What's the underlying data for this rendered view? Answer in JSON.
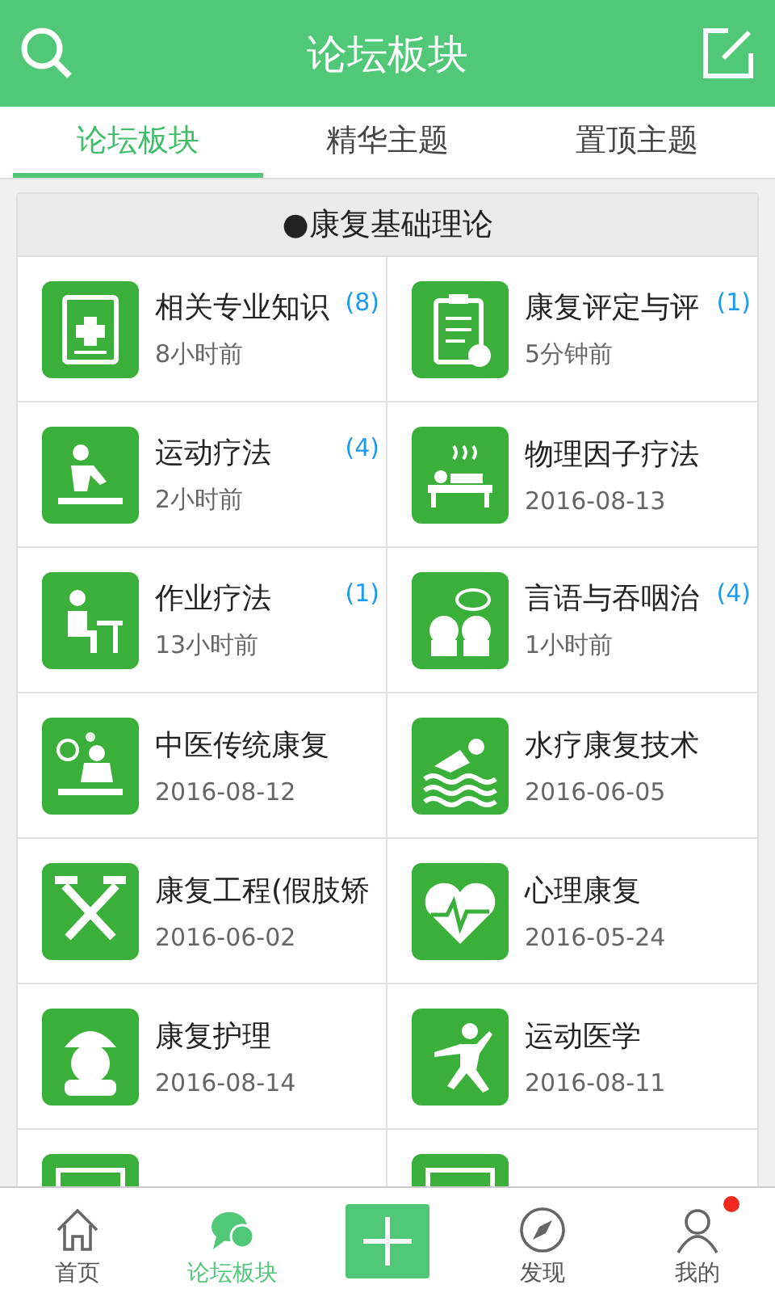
{
  "header": {
    "title": "论坛板块"
  },
  "tabs": [
    {
      "label": "论坛板块",
      "selected": true
    },
    {
      "label": "精华主题",
      "selected": false
    },
    {
      "label": "置顶主题",
      "selected": false
    }
  ],
  "section": {
    "title": "●康复基础理论"
  },
  "boards": [
    {
      "kind": "board",
      "title": "相关专业知识",
      "count": "(8)",
      "time": "8小时前"
    },
    {
      "kind": "board",
      "title": "康复评定与评",
      "count": "(1)",
      "time": "5分钟前"
    },
    {
      "kind": "board",
      "title": "运动疗法",
      "count": "(4)",
      "time": "2小时前"
    },
    {
      "kind": "board",
      "title": "物理因子疗法",
      "time": "2016-08-13"
    },
    {
      "kind": "board",
      "title": "作业疗法",
      "count": "(1)",
      "time": "13小时前"
    },
    {
      "kind": "board",
      "title": "言语与吞咽治",
      "count": "(4)",
      "time": "1小时前"
    },
    {
      "kind": "board",
      "title": "中医传统康复",
      "time": "2016-08-12"
    },
    {
      "kind": "board",
      "title": "水疗康复技术",
      "time": "2016-06-05"
    },
    {
      "kind": "board",
      "title": "康复工程(假肢矫",
      "time": "2016-06-02"
    },
    {
      "kind": "board",
      "title": "心理康复",
      "time": "2016-05-24"
    },
    {
      "kind": "board",
      "title": "康复护理",
      "time": "2016-08-14"
    },
    {
      "kind": "board",
      "title": "运动医学",
      "time": "2016-08-11"
    },
    {
      "kind": "partial"
    },
    {
      "kind": "partial"
    }
  ],
  "nav": [
    {
      "label": "首页",
      "selected": false,
      "kind": "tab"
    },
    {
      "label": "论坛板块",
      "selected": true,
      "kind": "tab"
    },
    {
      "kind": "add"
    },
    {
      "label": "发现",
      "selected": false,
      "kind": "tab"
    },
    {
      "label": "我的",
      "selected": false,
      "kind": "tab",
      "badge": true
    }
  ]
}
